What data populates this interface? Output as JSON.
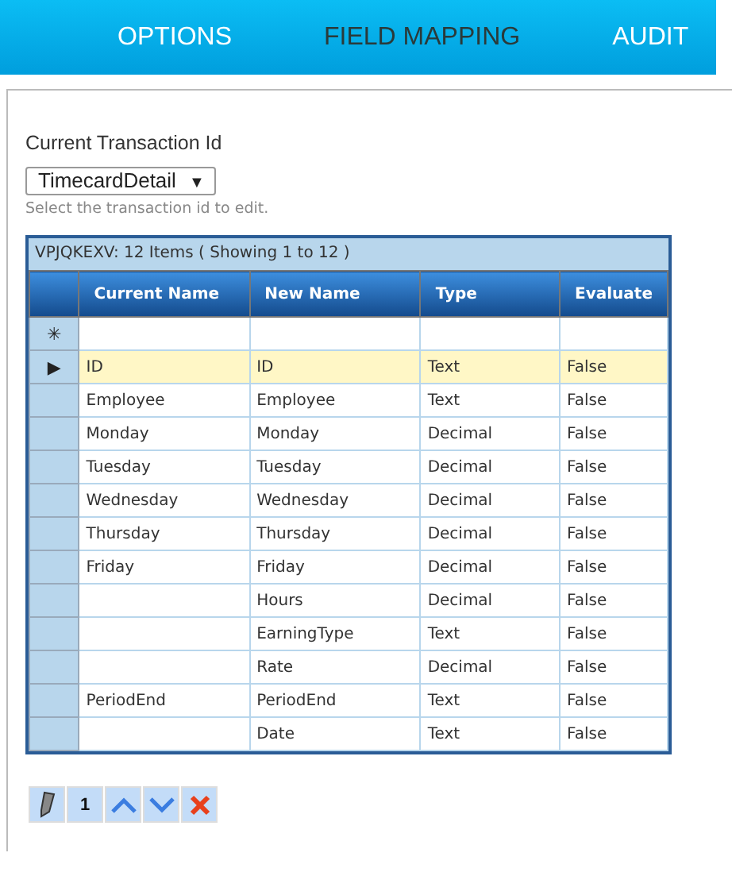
{
  "tabs": [
    {
      "label": "OPTIONS",
      "selected": false
    },
    {
      "label": "FIELD MAPPING",
      "selected": true
    },
    {
      "label": "AUDIT",
      "selected": false
    }
  ],
  "transaction": {
    "label": "Current Transaction Id",
    "value": "TimecardDetail",
    "arrow": "▼",
    "hint": "Select the transaction id to edit."
  },
  "grid": {
    "caption": "VPJQKEXV: 12 Items ( Showing 1 to 12 )",
    "new_row_marker": "✳",
    "current_marker": "▶",
    "columns": [
      "Current Name",
      "New Name",
      "Type",
      "Evaluate"
    ],
    "rows": [
      {
        "cells": [
          "ID",
          "ID",
          "Text",
          "False"
        ],
        "selected": true
      },
      {
        "cells": [
          "Employee",
          "Employee",
          "Text",
          "False"
        ],
        "selected": false
      },
      {
        "cells": [
          "Monday",
          "Monday",
          "Decimal",
          "False"
        ],
        "selected": false
      },
      {
        "cells": [
          "Tuesday",
          "Tuesday",
          "Decimal",
          "False"
        ],
        "selected": false
      },
      {
        "cells": [
          "Wednesday",
          "Wednesday",
          "Decimal",
          "False"
        ],
        "selected": false
      },
      {
        "cells": [
          "Thursday",
          "Thursday",
          "Decimal",
          "False"
        ],
        "selected": false
      },
      {
        "cells": [
          "Friday",
          "Friday",
          "Decimal",
          "False"
        ],
        "selected": false
      },
      {
        "cells": [
          "",
          "Hours",
          "Decimal",
          "False"
        ],
        "selected": false
      },
      {
        "cells": [
          "",
          "EarningType",
          "Text",
          "False"
        ],
        "selected": false
      },
      {
        "cells": [
          "",
          "Rate",
          "Decimal",
          "False"
        ],
        "selected": false
      },
      {
        "cells": [
          "PeriodEnd",
          "PeriodEnd",
          "Text",
          "False"
        ],
        "selected": false
      },
      {
        "cells": [
          "",
          "Date",
          "Text",
          "False"
        ],
        "selected": false
      }
    ]
  },
  "toolbar": {
    "page": "1"
  }
}
